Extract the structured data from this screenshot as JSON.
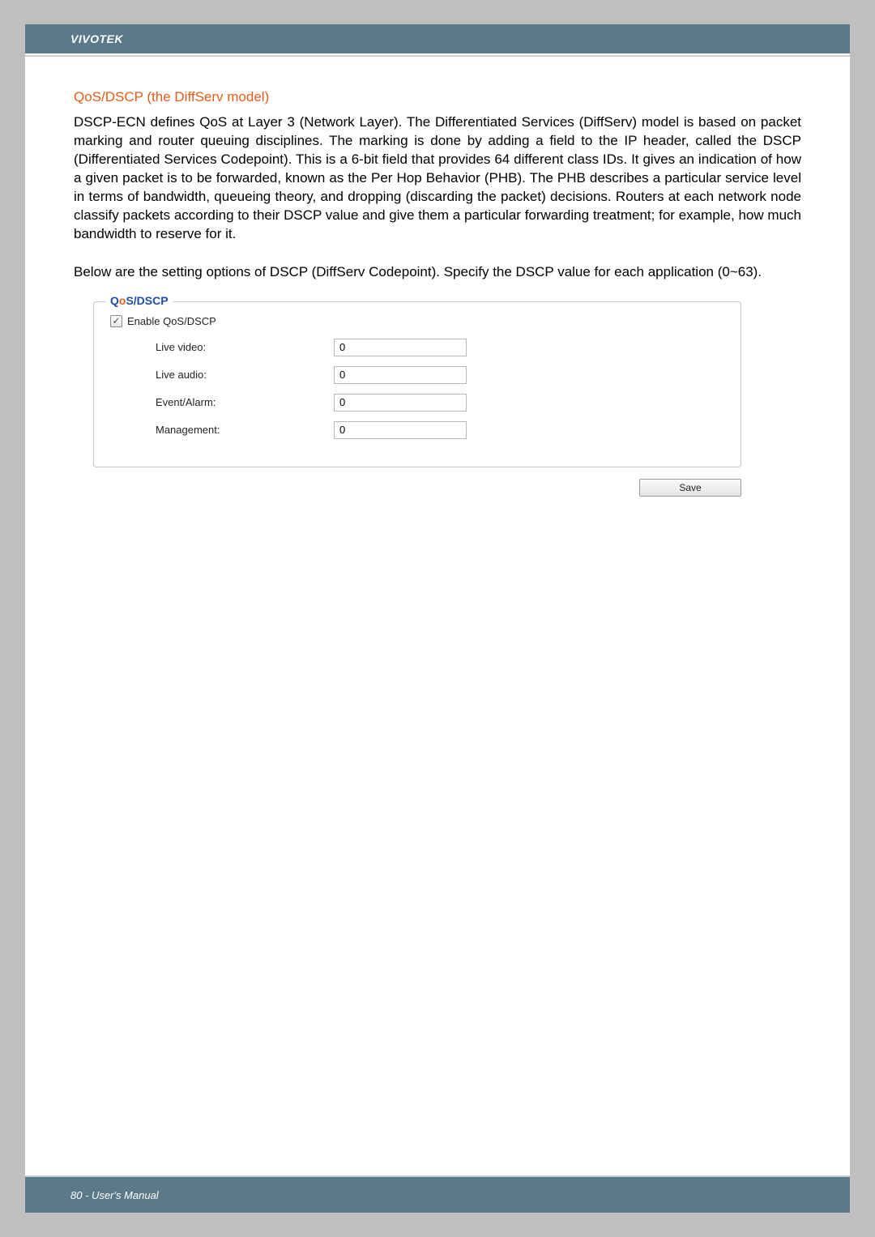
{
  "header": {
    "brand": "VIVOTEK"
  },
  "section": {
    "title": "QoS/DSCP (the DiffServ model)",
    "paragraph1": "DSCP-ECN defines QoS at Layer 3 (Network Layer). The Differentiated Services (DiffServ) model is based on packet marking and router queuing disciplines. The marking is done by adding a field to the IP header, called the DSCP (Differentiated Services Codepoint). This is a 6-bit field that provides 64 different class IDs. It gives an indication of how a given packet is to be forwarded, known as the Per Hop Behavior (PHB). The PHB describes a particular service level in terms of bandwidth, queueing theory, and dropping (discarding the packet) decisions. Routers at each network node classify packets according to their DSCP value and give them a particular forwarding treatment; for example, how much bandwidth to reserve for it.",
    "paragraph2": "Below are the setting options of DSCP (DiffServ Codepoint). Specify the DSCP value for each application (0~63)."
  },
  "panel": {
    "legend_q": "Q",
    "legend_o": "o",
    "legend_rest": "S/DSCP",
    "enable_label": "Enable QoS/DSCP",
    "fields": {
      "live_video": {
        "label": "Live video:",
        "value": "0"
      },
      "live_audio": {
        "label": "Live audio:",
        "value": "0"
      },
      "event_alarm": {
        "label": "Event/Alarm:",
        "value": "0"
      },
      "management": {
        "label": "Management:",
        "value": "0"
      }
    },
    "save_label": "Save"
  },
  "footer": {
    "text": "80 - User's Manual"
  }
}
